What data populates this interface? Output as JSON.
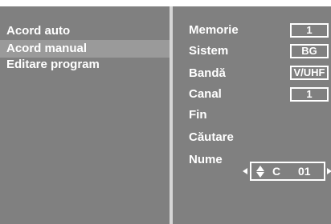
{
  "menu": {
    "items": [
      {
        "label": "Acord auto"
      },
      {
        "label": "Acord manual",
        "selected": true
      },
      {
        "label": "Editare program"
      }
    ]
  },
  "params": {
    "memorie": {
      "label": "Memorie",
      "value": "1"
    },
    "sistem": {
      "label": "Sistem",
      "value": "BG"
    },
    "banda": {
      "label": "Bandă",
      "value": "V/UHF"
    },
    "canal": {
      "label": "Canal",
      "value": "1"
    },
    "fin": {
      "label": "Fin"
    },
    "cautare": {
      "label": "Căutare"
    },
    "nume": {
      "label": "Nume",
      "letter": "C",
      "number": "01"
    }
  },
  "icons": {
    "left_arrow": "arrow-left-icon",
    "right_arrow": "arrow-right-icon",
    "updown": "up-down-icon"
  },
  "colors": {
    "panel": "#808080",
    "selected": "#9a9a9a",
    "divider": "#d6d6d6",
    "text": "#ffffff"
  }
}
